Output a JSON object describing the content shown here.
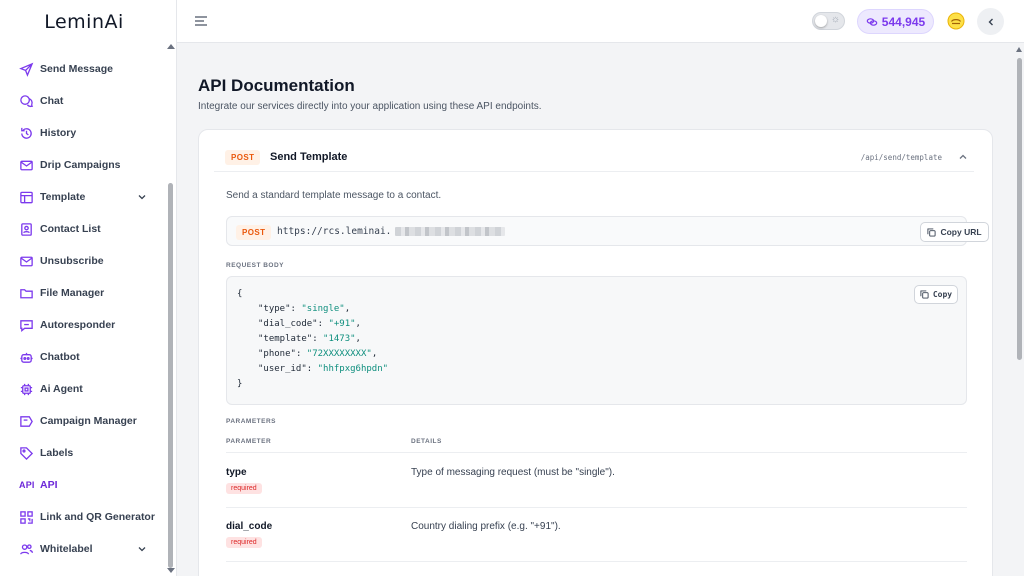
{
  "app": {
    "logo": "LeminAi"
  },
  "sidebar": {
    "items": [
      {
        "label": "Send Message",
        "icon": "send-icon"
      },
      {
        "label": "Chat",
        "icon": "chat-icon"
      },
      {
        "label": "History",
        "icon": "history-icon"
      },
      {
        "label": "Drip Campaigns",
        "icon": "mail-icon"
      },
      {
        "label": "Template",
        "icon": "template-icon",
        "expandable": true
      },
      {
        "label": "Contact List",
        "icon": "contacts-icon"
      },
      {
        "label": "Unsubscribe",
        "icon": "unsubscribe-icon"
      },
      {
        "label": "File Manager",
        "icon": "folder-icon"
      },
      {
        "label": "Autoresponder",
        "icon": "autoresponder-icon"
      },
      {
        "label": "Chatbot",
        "icon": "bot-icon"
      },
      {
        "label": "Ai Agent",
        "icon": "chip-icon"
      },
      {
        "label": "Campaign Manager",
        "icon": "campaign-icon"
      },
      {
        "label": "Labels",
        "icon": "tag-icon"
      },
      {
        "label": "API",
        "icon": "api-icon",
        "active": true,
        "icon_text": "API"
      },
      {
        "label": "Link and QR Generator",
        "icon": "qr-icon"
      },
      {
        "label": "Whitelabel",
        "icon": "users-icon",
        "expandable": true
      }
    ]
  },
  "header": {
    "credits": "544,945",
    "accent": "#7c3aed"
  },
  "main": {
    "title": "API Documentation",
    "subtitle": "Integrate our services directly into your application using these API endpoints.",
    "endpoint": {
      "method": "POST",
      "title": "Send Template",
      "path": "/api/send/template",
      "description": "Send a standard template message to a contact.",
      "url": "https://rcs.leminai.",
      "copy_url_label": "Copy URL",
      "request_body_label": "REQUEST BODY",
      "copy_label": "Copy",
      "body": {
        "open": "{",
        "close": "}",
        "lines": [
          {
            "key": "\"type\"",
            "value": "\"single\"",
            "sep": ": ",
            "trail": ","
          },
          {
            "key": "\"dial_code\"",
            "value": "\"+91\"",
            "sep": ": ",
            "trail": ","
          },
          {
            "key": "\"template\"",
            "value": "\"1473\"",
            "sep": ": ",
            "trail": ","
          },
          {
            "key": "\"phone\"",
            "value": "\"72XXXXXXXX\"",
            "sep": ": ",
            "trail": ","
          },
          {
            "key": "\"user_id\"",
            "value": "\"hhfpxg6hpdn\"",
            "sep": ": ",
            "trail": ""
          }
        ]
      },
      "parameters_label": "PARAMETERS",
      "columns": [
        "PARAMETER",
        "DETAILS"
      ],
      "parameters": [
        {
          "name": "type",
          "badge": "required",
          "details": "Type of messaging request (must be \"single\")."
        },
        {
          "name": "dial_code",
          "badge": "required",
          "details": "Country dialing prefix (e.g. \"+91\")."
        }
      ]
    }
  }
}
